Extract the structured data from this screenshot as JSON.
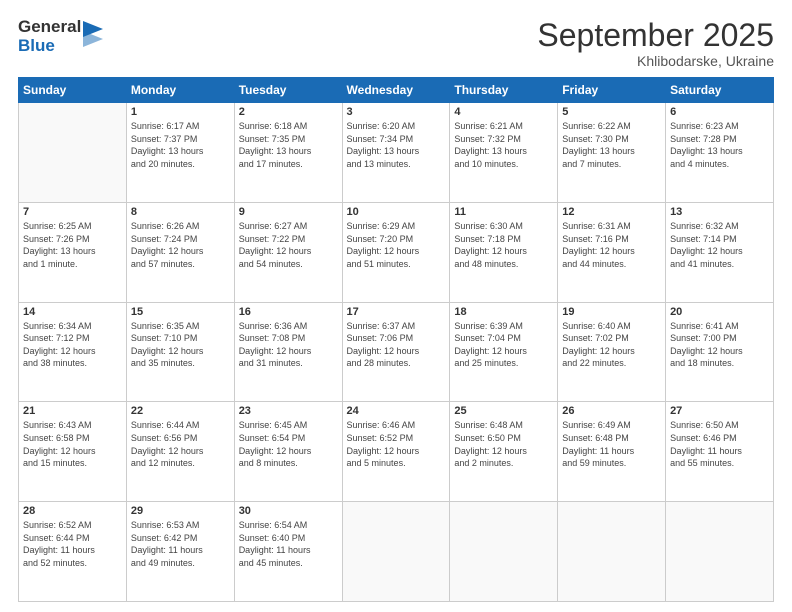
{
  "header": {
    "logo_general": "General",
    "logo_blue": "Blue",
    "month_title": "September 2025",
    "location": "Khlibodarske, Ukraine"
  },
  "days_of_week": [
    "Sunday",
    "Monday",
    "Tuesday",
    "Wednesday",
    "Thursday",
    "Friday",
    "Saturday"
  ],
  "weeks": [
    [
      {
        "day": "",
        "info": ""
      },
      {
        "day": "1",
        "info": "Sunrise: 6:17 AM\nSunset: 7:37 PM\nDaylight: 13 hours\nand 20 minutes."
      },
      {
        "day": "2",
        "info": "Sunrise: 6:18 AM\nSunset: 7:35 PM\nDaylight: 13 hours\nand 17 minutes."
      },
      {
        "day": "3",
        "info": "Sunrise: 6:20 AM\nSunset: 7:34 PM\nDaylight: 13 hours\nand 13 minutes."
      },
      {
        "day": "4",
        "info": "Sunrise: 6:21 AM\nSunset: 7:32 PM\nDaylight: 13 hours\nand 10 minutes."
      },
      {
        "day": "5",
        "info": "Sunrise: 6:22 AM\nSunset: 7:30 PM\nDaylight: 13 hours\nand 7 minutes."
      },
      {
        "day": "6",
        "info": "Sunrise: 6:23 AM\nSunset: 7:28 PM\nDaylight: 13 hours\nand 4 minutes."
      }
    ],
    [
      {
        "day": "7",
        "info": "Sunrise: 6:25 AM\nSunset: 7:26 PM\nDaylight: 13 hours\nand 1 minute."
      },
      {
        "day": "8",
        "info": "Sunrise: 6:26 AM\nSunset: 7:24 PM\nDaylight: 12 hours\nand 57 minutes."
      },
      {
        "day": "9",
        "info": "Sunrise: 6:27 AM\nSunset: 7:22 PM\nDaylight: 12 hours\nand 54 minutes."
      },
      {
        "day": "10",
        "info": "Sunrise: 6:29 AM\nSunset: 7:20 PM\nDaylight: 12 hours\nand 51 minutes."
      },
      {
        "day": "11",
        "info": "Sunrise: 6:30 AM\nSunset: 7:18 PM\nDaylight: 12 hours\nand 48 minutes."
      },
      {
        "day": "12",
        "info": "Sunrise: 6:31 AM\nSunset: 7:16 PM\nDaylight: 12 hours\nand 44 minutes."
      },
      {
        "day": "13",
        "info": "Sunrise: 6:32 AM\nSunset: 7:14 PM\nDaylight: 12 hours\nand 41 minutes."
      }
    ],
    [
      {
        "day": "14",
        "info": "Sunrise: 6:34 AM\nSunset: 7:12 PM\nDaylight: 12 hours\nand 38 minutes."
      },
      {
        "day": "15",
        "info": "Sunrise: 6:35 AM\nSunset: 7:10 PM\nDaylight: 12 hours\nand 35 minutes."
      },
      {
        "day": "16",
        "info": "Sunrise: 6:36 AM\nSunset: 7:08 PM\nDaylight: 12 hours\nand 31 minutes."
      },
      {
        "day": "17",
        "info": "Sunrise: 6:37 AM\nSunset: 7:06 PM\nDaylight: 12 hours\nand 28 minutes."
      },
      {
        "day": "18",
        "info": "Sunrise: 6:39 AM\nSunset: 7:04 PM\nDaylight: 12 hours\nand 25 minutes."
      },
      {
        "day": "19",
        "info": "Sunrise: 6:40 AM\nSunset: 7:02 PM\nDaylight: 12 hours\nand 22 minutes."
      },
      {
        "day": "20",
        "info": "Sunrise: 6:41 AM\nSunset: 7:00 PM\nDaylight: 12 hours\nand 18 minutes."
      }
    ],
    [
      {
        "day": "21",
        "info": "Sunrise: 6:43 AM\nSunset: 6:58 PM\nDaylight: 12 hours\nand 15 minutes."
      },
      {
        "day": "22",
        "info": "Sunrise: 6:44 AM\nSunset: 6:56 PM\nDaylight: 12 hours\nand 12 minutes."
      },
      {
        "day": "23",
        "info": "Sunrise: 6:45 AM\nSunset: 6:54 PM\nDaylight: 12 hours\nand 8 minutes."
      },
      {
        "day": "24",
        "info": "Sunrise: 6:46 AM\nSunset: 6:52 PM\nDaylight: 12 hours\nand 5 minutes."
      },
      {
        "day": "25",
        "info": "Sunrise: 6:48 AM\nSunset: 6:50 PM\nDaylight: 12 hours\nand 2 minutes."
      },
      {
        "day": "26",
        "info": "Sunrise: 6:49 AM\nSunset: 6:48 PM\nDaylight: 11 hours\nand 59 minutes."
      },
      {
        "day": "27",
        "info": "Sunrise: 6:50 AM\nSunset: 6:46 PM\nDaylight: 11 hours\nand 55 minutes."
      }
    ],
    [
      {
        "day": "28",
        "info": "Sunrise: 6:52 AM\nSunset: 6:44 PM\nDaylight: 11 hours\nand 52 minutes."
      },
      {
        "day": "29",
        "info": "Sunrise: 6:53 AM\nSunset: 6:42 PM\nDaylight: 11 hours\nand 49 minutes."
      },
      {
        "day": "30",
        "info": "Sunrise: 6:54 AM\nSunset: 6:40 PM\nDaylight: 11 hours\nand 45 minutes."
      },
      {
        "day": "",
        "info": ""
      },
      {
        "day": "",
        "info": ""
      },
      {
        "day": "",
        "info": ""
      },
      {
        "day": "",
        "info": ""
      }
    ]
  ]
}
